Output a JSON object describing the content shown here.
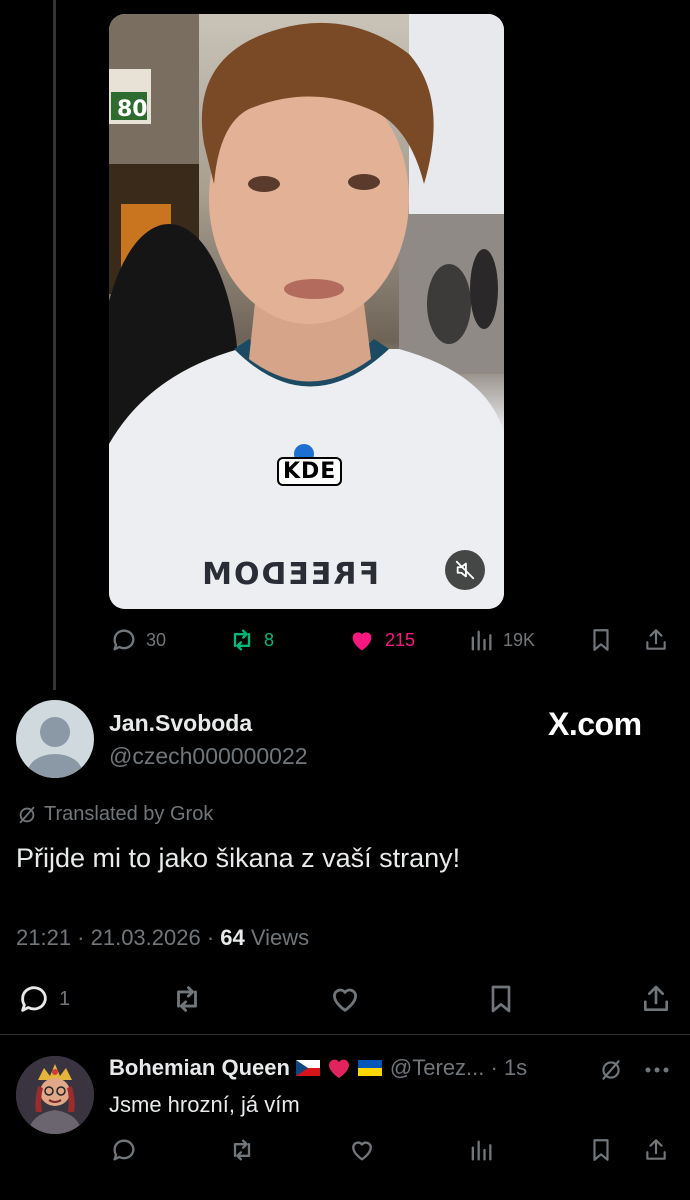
{
  "video": {
    "caption_word": "KDE",
    "shirt_text": "FREEDOM"
  },
  "parent_actions": {
    "replies": "30",
    "reposts": "8",
    "likes": "215",
    "views": "19K"
  },
  "tweet": {
    "name": "Jan.Svoboda",
    "handle": "@czech000000022",
    "watermark": "X.com",
    "translated_label": "Translated by Grok",
    "text": "Přijde mi to jako šikana z vaší strany!",
    "time": "21:21 · 21.03.2026 · ",
    "views_count": "64",
    "views_label": " Views",
    "replies": "1"
  },
  "reply": {
    "name": "Bohemian Queen",
    "handle": "@Terez... · 1s",
    "text": "Jsme hrozní, já vím"
  },
  "colors": {
    "background": "#000000",
    "muted": "#71767b",
    "repost_green": "#00ba7c",
    "like_pink": "#f91880"
  },
  "icons": [
    "reply-icon",
    "repost-icon",
    "like-icon",
    "views-icon",
    "bookmark-icon",
    "share-icon",
    "mute-icon",
    "translate-icon",
    "more-icon"
  ]
}
